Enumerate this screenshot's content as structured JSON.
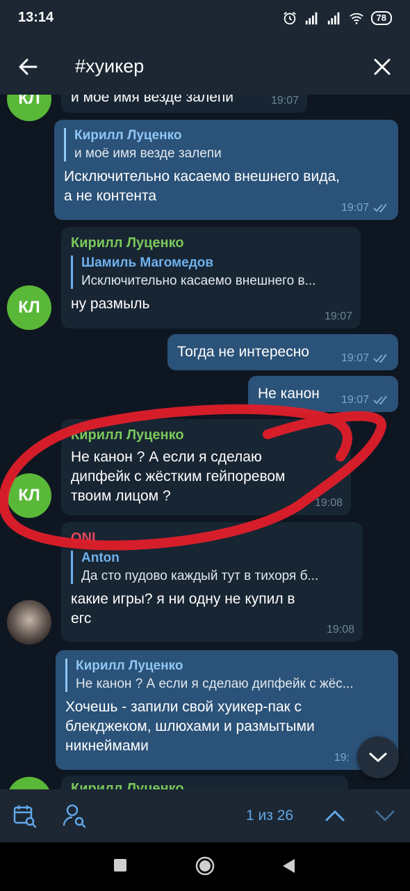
{
  "status": {
    "time": "13:14",
    "battery": "78",
    "icons": [
      "alarm-icon",
      "signal-icon",
      "signal-icon",
      "wifi-icon",
      "battery-icon"
    ]
  },
  "topbar": {
    "search_query": "#хуикер",
    "back_icon": "arrow-left-icon",
    "close_icon": "close-icon"
  },
  "messages": [
    {
      "avatar": "КЛ",
      "text": "и мое имя везде залепи",
      "time": "19:07"
    },
    {
      "reply_name": "Кирилл Луценко",
      "reply_text": "и моё имя везде залепи",
      "text_lines": [
        "Исключительно касаемо внешнего вида,",
        "а не контента"
      ],
      "time": "19:07"
    },
    {
      "sender": "Кирилл Луценко",
      "reply_name": "Шамиль Магомедов",
      "reply_text": "Исключительно касаемо внешнего в...",
      "text": "ну размыль",
      "time": "19:07",
      "avatar": "КЛ"
    },
    {
      "text": "Тогда не интересно",
      "time": "19:07"
    },
    {
      "text": "Не канон",
      "time": "19:07"
    },
    {
      "sender": "Кирилл Луценко",
      "text_lines": [
        "Не канон ? А если я сделаю",
        "дипфейк с жёстким гейпоревом",
        "твоим лицом ?"
      ],
      "time": "19:08",
      "avatar": "КЛ"
    },
    {
      "sender": "ONI",
      "reply_name": "Anton",
      "reply_text": "Да сто пудово каждый тут в тихоря б...",
      "text_lines": [
        "какие игры? я ни одну не купил в",
        "егс"
      ],
      "time": "19:08"
    },
    {
      "reply_name": "Кирилл Луценко",
      "reply_text": "Не канон ? А если я сделаю дипфейк с жёс...",
      "text_lines": [
        "Хочешь - запили свой хуикер-пак с",
        "блекджеком, шлюхами и размытыми",
        "никнеймами"
      ],
      "time": "19:"
    },
    {
      "sender": "Кирилл Луценко"
    }
  ],
  "bottom": {
    "counter": "1 из 26",
    "icons": [
      "calendar-search-icon",
      "user-search-icon",
      "chevron-up-icon",
      "chevron-down-icon"
    ]
  },
  "colors": {
    "header": "#1c2733",
    "chat_bg": "#0e1621",
    "incoming": "#182533",
    "outgoing": "#2b5278",
    "accent": "#62a7e9",
    "sender_green": "#79c85a",
    "sender_pink": "#e5475a",
    "annotation_red": "#e01e2b"
  }
}
